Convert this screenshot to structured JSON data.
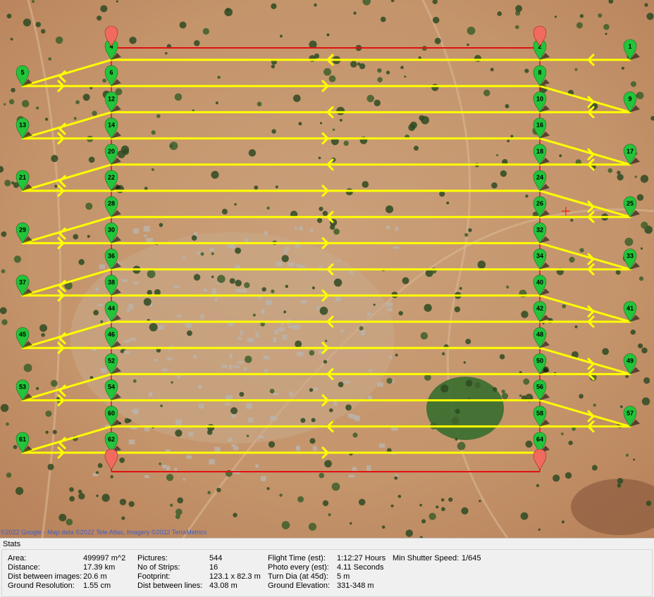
{
  "map": {
    "attribution": "©2022 Google - Map data ©2022 Tele Atlas, Imagery ©2022 TerraMetrics",
    "colors": {
      "flight_path": "#ffff00",
      "boundary": "#e01010",
      "waypoint": "#22c43a",
      "boundary_marker": "#f06a5e",
      "cursor": "#ff0000"
    },
    "waypoints": [
      {
        "label": "1",
        "side": "outer-right",
        "strip": 1
      },
      {
        "label": "2",
        "side": "right",
        "strip": 1
      },
      {
        "label": "4",
        "side": "left",
        "strip": 1
      },
      {
        "label": "5",
        "side": "outer-left",
        "strip": 2
      },
      {
        "label": "6",
        "side": "left",
        "strip": 2
      },
      {
        "label": "8",
        "side": "right",
        "strip": 2
      },
      {
        "label": "9",
        "side": "outer-right",
        "strip": 3
      },
      {
        "label": "10",
        "side": "right",
        "strip": 3
      },
      {
        "label": "12",
        "side": "left",
        "strip": 3
      },
      {
        "label": "13",
        "side": "outer-left",
        "strip": 4
      },
      {
        "label": "14",
        "side": "left",
        "strip": 4
      },
      {
        "label": "16",
        "side": "right",
        "strip": 4
      },
      {
        "label": "17",
        "side": "outer-right",
        "strip": 5
      },
      {
        "label": "18",
        "side": "right",
        "strip": 5
      },
      {
        "label": "20",
        "side": "left",
        "strip": 5
      },
      {
        "label": "21",
        "side": "outer-left",
        "strip": 6
      },
      {
        "label": "22",
        "side": "left",
        "strip": 6
      },
      {
        "label": "24",
        "side": "right",
        "strip": 6
      },
      {
        "label": "25",
        "side": "outer-right",
        "strip": 7
      },
      {
        "label": "26",
        "side": "right",
        "strip": 7
      },
      {
        "label": "28",
        "side": "left",
        "strip": 7
      },
      {
        "label": "29",
        "side": "outer-left",
        "strip": 8
      },
      {
        "label": "30",
        "side": "left",
        "strip": 8
      },
      {
        "label": "32",
        "side": "right",
        "strip": 8
      },
      {
        "label": "33",
        "side": "outer-right",
        "strip": 9
      },
      {
        "label": "34",
        "side": "right",
        "strip": 9
      },
      {
        "label": "36",
        "side": "left",
        "strip": 9
      },
      {
        "label": "37",
        "side": "outer-left",
        "strip": 10
      },
      {
        "label": "38",
        "side": "left",
        "strip": 10
      },
      {
        "label": "40",
        "side": "right",
        "strip": 10
      },
      {
        "label": "41",
        "side": "outer-right",
        "strip": 11
      },
      {
        "label": "42",
        "side": "right",
        "strip": 11
      },
      {
        "label": "44",
        "side": "left",
        "strip": 11
      },
      {
        "label": "45",
        "side": "outer-left",
        "strip": 12
      },
      {
        "label": "46",
        "side": "left",
        "strip": 12
      },
      {
        "label": "48",
        "side": "right",
        "strip": 12
      },
      {
        "label": "49",
        "side": "outer-right",
        "strip": 13
      },
      {
        "label": "50",
        "side": "right",
        "strip": 13
      },
      {
        "label": "52",
        "side": "left",
        "strip": 13
      },
      {
        "label": "53",
        "side": "outer-left",
        "strip": 14
      },
      {
        "label": "54",
        "side": "left",
        "strip": 14
      },
      {
        "label": "56",
        "side": "right",
        "strip": 14
      },
      {
        "label": "57",
        "side": "outer-right",
        "strip": 15
      },
      {
        "label": "58",
        "side": "right",
        "strip": 15
      },
      {
        "label": "60",
        "side": "left",
        "strip": 15
      },
      {
        "label": "61",
        "side": "outer-left",
        "strip": 16
      },
      {
        "label": "62",
        "side": "left",
        "strip": 16
      },
      {
        "label": "64",
        "side": "right",
        "strip": 16
      }
    ]
  },
  "stats": {
    "title": "Stats",
    "items": [
      {
        "label": "Area:",
        "value": "499997 m^2"
      },
      {
        "label": "Distance:",
        "value": "17.39 km"
      },
      {
        "label": "Dist between images:",
        "value": "20.6 m"
      },
      {
        "label": "Ground Resolution:",
        "value": "1.55 cm"
      },
      {
        "label": "Pictures:",
        "value": "544"
      },
      {
        "label": "No of Strips:",
        "value": "16"
      },
      {
        "label": "Footprint:",
        "value": "123.1 x 82.3 m"
      },
      {
        "label": "Dist between lines:",
        "value": "43.08 m"
      },
      {
        "label": "Flight Time (est):",
        "value": "1:12:27 Hours"
      },
      {
        "label": "Photo every (est):",
        "value": "4.11 Seconds"
      },
      {
        "label": "Turn Dia (at 45d):",
        "value": "5 m"
      },
      {
        "label": "Ground Elevation:",
        "value": "331-348 m"
      },
      {
        "label": "Min Shutter Speed:",
        "value": "1/645"
      }
    ]
  }
}
